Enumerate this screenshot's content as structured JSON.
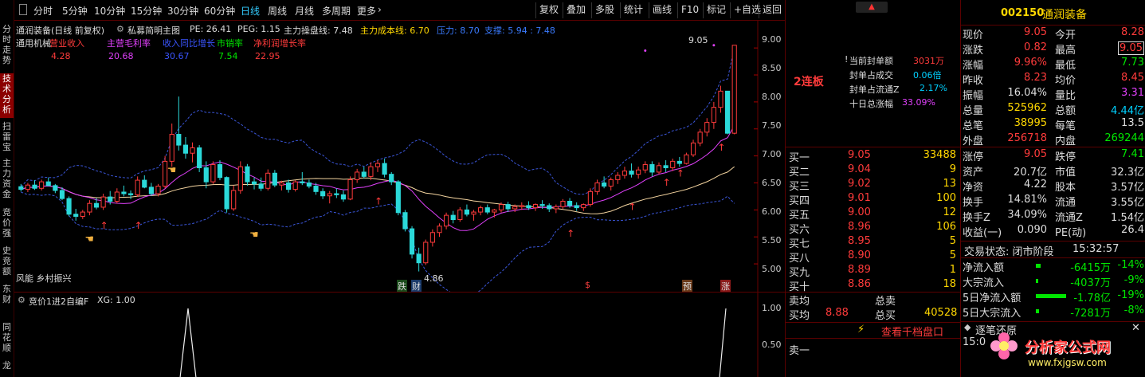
{
  "side_tabs": [
    "分时走势",
    "技术分析",
    "扫雷宝",
    "主力资金",
    "竞价强",
    "史竞额",
    "东财",
    "同花顺",
    "龙"
  ],
  "periods": [
    "分时",
    "5分钟",
    "10分钟",
    "15分钟",
    "30分钟",
    "60分钟",
    "日线",
    "周线",
    "月线",
    "多周期",
    "更多"
  ],
  "toolbar": [
    "复权",
    "叠加",
    "多股",
    "统计",
    "画线",
    "F10",
    "标记",
    "+自选",
    "返回"
  ],
  "chart": {
    "header": {
      "name": "通润装备",
      "mode": "(日线 前复权)",
      "formula": "私募简明主图",
      "pe": "PE: 26.41",
      "peg": "PEG: 1.15",
      "zl": "主力操盘线: 7.48",
      "cost": "主力成本线: 6.70",
      "press": "压力: 8.70",
      "support": "支撑: 5.94 : 7.48"
    },
    "fund_labels": [
      "通用机械",
      "营业收入",
      "主营毛利率",
      "收入同比增长",
      "市销率",
      "净利润增长率"
    ],
    "fund_values": [
      "4.28",
      "20.68",
      "30.67",
      "7.54",
      "22.95"
    ],
    "concept": "风能 乡村振兴",
    "yaxis": [
      "9.00",
      "8.50",
      "8.00",
      "7.50",
      "7.00",
      "6.50",
      "6.00",
      "5.50",
      "5.00"
    ],
    "hi_label": "9.05",
    "lo_label": "4.86",
    "markers": [
      "跌",
      "财",
      "$",
      "预",
      "涨"
    ],
    "chart_data": {
      "type": "candlestick",
      "ylim": [
        4.75,
        9.15
      ],
      "ohlc": [
        [
          6.43,
          6.48,
          6.34,
          6.38
        ],
        [
          6.38,
          6.5,
          6.33,
          6.46
        ],
        [
          6.46,
          6.55,
          6.37,
          6.4
        ],
        [
          6.4,
          6.56,
          6.36,
          6.52
        ],
        [
          6.52,
          6.6,
          6.44,
          6.45
        ],
        [
          6.45,
          6.48,
          6.31,
          6.36
        ],
        [
          6.36,
          6.42,
          6.18,
          6.21
        ],
        [
          6.21,
          6.25,
          5.88,
          5.92
        ],
        [
          5.92,
          6.02,
          5.8,
          5.88
        ],
        [
          5.88,
          6.0,
          5.83,
          5.96
        ],
        [
          5.96,
          6.18,
          5.9,
          6.12
        ],
        [
          6.12,
          6.22,
          6.01,
          6.05
        ],
        [
          6.05,
          6.3,
          6.0,
          6.24
        ],
        [
          6.24,
          6.35,
          6.1,
          6.16
        ],
        [
          6.16,
          6.4,
          6.12,
          6.33
        ],
        [
          6.33,
          6.45,
          6.25,
          6.3
        ],
        [
          6.3,
          6.36,
          6.2,
          6.28
        ],
        [
          6.28,
          6.62,
          6.24,
          6.55
        ],
        [
          6.55,
          6.64,
          6.4,
          6.42
        ],
        [
          6.42,
          6.5,
          6.26,
          6.3
        ],
        [
          6.3,
          6.48,
          6.25,
          6.44
        ],
        [
          6.44,
          7.0,
          6.4,
          6.9
        ],
        [
          6.9,
          7.6,
          6.8,
          7.4
        ],
        [
          7.4,
          8.1,
          7.1,
          7.2
        ],
        [
          7.2,
          7.35,
          6.95,
          7.05
        ],
        [
          7.05,
          7.25,
          6.88,
          7.15
        ],
        [
          7.15,
          7.2,
          6.7,
          6.78
        ],
        [
          6.78,
          6.9,
          6.4,
          6.52
        ],
        [
          6.52,
          6.9,
          6.48,
          6.84
        ],
        [
          6.84,
          6.92,
          6.55,
          6.6
        ],
        [
          6.6,
          6.62,
          5.95,
          6.02
        ],
        [
          6.02,
          6.45,
          5.98,
          6.36
        ],
        [
          6.36,
          6.9,
          6.3,
          6.8
        ],
        [
          6.8,
          6.85,
          6.45,
          6.52
        ],
        [
          6.52,
          6.6,
          6.38,
          6.48
        ],
        [
          6.48,
          6.6,
          6.35,
          6.4
        ],
        [
          6.4,
          6.75,
          6.36,
          6.68
        ],
        [
          6.68,
          6.74,
          6.42,
          6.46
        ],
        [
          6.46,
          6.54,
          6.36,
          6.5
        ],
        [
          6.5,
          6.56,
          6.32,
          6.38
        ],
        [
          6.38,
          6.55,
          6.34,
          6.52
        ],
        [
          6.52,
          6.7,
          6.46,
          6.5
        ],
        [
          6.5,
          6.56,
          6.4,
          6.44
        ],
        [
          6.44,
          6.5,
          6.28,
          6.34
        ],
        [
          6.34,
          6.4,
          6.2,
          6.26
        ],
        [
          6.26,
          6.35,
          6.12,
          6.3
        ],
        [
          6.3,
          6.4,
          6.22,
          6.28
        ],
        [
          6.28,
          6.36,
          6.15,
          6.2
        ],
        [
          6.2,
          6.62,
          6.18,
          6.56
        ],
        [
          6.56,
          6.76,
          6.5,
          6.7
        ],
        [
          6.7,
          6.8,
          6.58,
          6.62
        ],
        [
          6.62,
          6.88,
          6.55,
          6.8
        ],
        [
          6.8,
          6.92,
          6.7,
          6.86
        ],
        [
          6.86,
          6.95,
          6.6,
          6.66
        ],
        [
          6.66,
          6.7,
          6.46,
          6.52
        ],
        [
          6.52,
          6.55,
          5.9,
          5.95
        ],
        [
          5.95,
          6.0,
          5.6,
          5.65
        ],
        [
          5.65,
          5.7,
          5.1,
          5.18
        ],
        [
          5.18,
          5.3,
          4.86,
          5.02
        ],
        [
          5.02,
          5.45,
          4.98,
          5.4
        ],
        [
          5.4,
          5.64,
          5.32,
          5.58
        ],
        [
          5.58,
          5.75,
          5.5,
          5.7
        ],
        [
          5.7,
          5.95,
          5.64,
          5.9
        ],
        [
          5.9,
          5.98,
          5.75,
          5.82
        ],
        [
          5.82,
          6.05,
          5.78,
          6.0
        ],
        [
          6.0,
          6.1,
          5.88,
          5.92
        ],
        [
          5.92,
          6.0,
          5.8,
          5.96
        ],
        [
          5.96,
          6.08,
          5.9,
          6.04
        ],
        [
          6.04,
          6.1,
          5.92,
          5.96
        ],
        [
          5.96,
          6.02,
          5.86,
          6.0
        ],
        [
          6.0,
          6.14,
          5.95,
          6.1
        ],
        [
          6.1,
          6.15,
          5.96,
          6.02
        ],
        [
          6.02,
          6.1,
          5.96,
          6.06
        ],
        [
          6.06,
          6.14,
          6.0,
          6.08
        ],
        [
          6.08,
          6.16,
          6.0,
          6.04
        ],
        [
          6.04,
          6.12,
          5.98,
          6.1
        ],
        [
          6.1,
          6.18,
          6.02,
          6.08
        ],
        [
          6.08,
          6.12,
          5.96,
          6.02
        ],
        [
          6.02,
          6.1,
          5.94,
          6.06
        ],
        [
          6.06,
          6.2,
          6.02,
          6.16
        ],
        [
          6.16,
          6.22,
          6.04,
          6.08
        ],
        [
          6.08,
          6.14,
          5.98,
          6.04
        ],
        [
          6.04,
          6.12,
          5.98,
          6.1
        ],
        [
          6.1,
          6.4,
          6.06,
          6.34
        ],
        [
          6.34,
          6.56,
          6.28,
          6.5
        ],
        [
          6.5,
          6.62,
          6.4,
          6.44
        ],
        [
          6.44,
          6.6,
          6.36,
          6.56
        ],
        [
          6.56,
          6.7,
          6.48,
          6.64
        ],
        [
          6.64,
          6.8,
          6.58,
          6.72
        ],
        [
          6.72,
          6.86,
          6.6,
          6.66
        ],
        [
          6.66,
          6.8,
          6.58,
          6.74
        ],
        [
          6.74,
          6.9,
          6.68,
          6.84
        ],
        [
          6.84,
          6.9,
          6.62,
          6.7
        ],
        [
          6.7,
          6.88,
          6.66,
          6.82
        ],
        [
          6.82,
          6.92,
          6.7,
          6.78
        ],
        [
          6.78,
          6.95,
          6.72,
          6.9
        ],
        [
          6.9,
          6.98,
          6.8,
          6.86
        ],
        [
          6.86,
          7.06,
          6.84,
          7.02
        ],
        [
          7.02,
          7.3,
          6.98,
          7.24
        ],
        [
          7.24,
          7.5,
          7.18,
          7.44
        ],
        [
          7.44,
          7.7,
          7.36,
          7.62
        ],
        [
          7.62,
          8.0,
          7.5,
          7.9
        ],
        [
          7.9,
          8.3,
          7.8,
          8.2
        ],
        [
          8.2,
          8.0,
          7.4,
          7.42
        ],
        [
          7.42,
          9.05,
          7.4,
          9.05
        ]
      ]
    }
  },
  "indicator": {
    "header": "竞价1进2自编F",
    "xg": "XG: 1.00",
    "yaxis": [
      "1.00",
      "0.50"
    ]
  },
  "mid": {
    "board": "2连板",
    "seal_rows": [
      [
        "当前封单额",
        "3031万"
      ],
      [
        "封单占成交",
        "0.06倍"
      ],
      [
        "封单占流通Z",
        "2.17%"
      ],
      [
        "十日总涨幅",
        "33.09%"
      ]
    ],
    "bids": [
      [
        "买一",
        "9.05",
        "33488"
      ],
      [
        "买二",
        "9.04",
        "9"
      ],
      [
        "买三",
        "9.02",
        "13"
      ],
      [
        "买四",
        "9.01",
        "100"
      ],
      [
        "买五",
        "9.00",
        "12"
      ],
      [
        "买六",
        "8.96",
        "106"
      ],
      [
        "买七",
        "8.95",
        "5"
      ],
      [
        "买八",
        "8.90",
        "5"
      ],
      [
        "买九",
        "8.89",
        "1"
      ],
      [
        "买十",
        "8.86",
        "18"
      ]
    ],
    "sell_avg_label": "卖均",
    "total_sell_label": "总卖",
    "buy_avg_label": "买均",
    "buy_avg": "8.88",
    "total_buy_label": "总买",
    "total_buy": "40528",
    "depth_link": "查看千档盘口",
    "ask1": "卖一"
  },
  "right": {
    "code": "002150",
    "name": "通润装备",
    "stats": [
      [
        "现价",
        "9.05",
        "今开",
        "8.28"
      ],
      [
        "涨跌",
        "0.82",
        "最高",
        "9.05"
      ],
      [
        "涨幅",
        "9.96%",
        "最低",
        "7.73"
      ],
      [
        "昨收",
        "8.23",
        "均价",
        "8.45"
      ],
      [
        "振幅",
        "16.04%",
        "量比",
        "3.31"
      ],
      [
        "总量",
        "525962",
        "总额",
        "4.44亿"
      ],
      [
        "总笔",
        "38995",
        "每笔",
        "13.5"
      ],
      [
        "外盘",
        "256718",
        "内盘",
        "269244"
      ]
    ],
    "stats2": [
      [
        "涨停",
        "9.05",
        "跌停",
        "7.41"
      ],
      [
        "资产",
        "20.7亿",
        "市值",
        "32.3亿"
      ],
      [
        "净资",
        "4.22",
        "股本",
        "3.57亿"
      ],
      [
        "换手",
        "14.81%",
        "流通",
        "3.55亿"
      ],
      [
        "换手Z",
        "34.09%",
        "流通Z",
        "1.54亿"
      ],
      [
        "收益(一)",
        "0.090",
        "PE(动)",
        "26.4"
      ]
    ],
    "trade_state": "交易状态: 闭市阶段",
    "trade_time": "15:32:57",
    "flows": [
      [
        "净流入额",
        "-6415万",
        "-14%"
      ],
      [
        "大宗流入",
        "-4037万",
        "-9%"
      ],
      [
        "5日净流入额",
        "-1.78亿",
        "-19%"
      ],
      [
        "5日大宗流入",
        "-7281万",
        "-8%"
      ]
    ],
    "tick_title": "逐笔还原",
    "tick_time": "15:0",
    "watermark": "分析家公式网",
    "watermark_url": "www.fxjgsw.com"
  },
  "colors": {
    "up": "#ff3b3b",
    "down": "#2bd9d9",
    "ma1": "#e040fb",
    "ma2": "#f5d5a0",
    "band": "#3a55d8",
    "grid": "#3a0000"
  }
}
